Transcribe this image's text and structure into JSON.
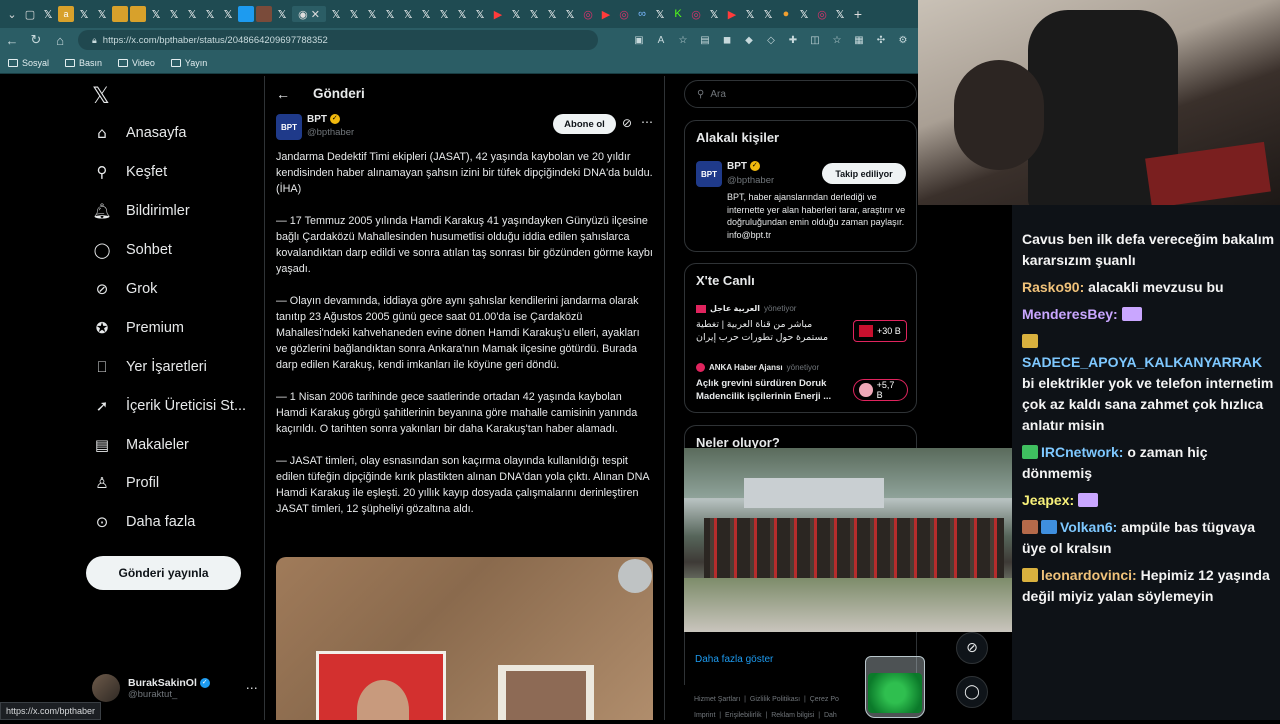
{
  "browser": {
    "url": "https://x.com/bpthaber/status/2048664209697788352",
    "bookmarks": [
      "Sosyal",
      "Basın",
      "Video",
      "Yayın"
    ],
    "status_url": "https://x.com/bpthaber"
  },
  "sidebar": {
    "items": [
      {
        "label": "Anasayfa",
        "icon": "home-icon"
      },
      {
        "label": "Keşfet",
        "icon": "search-icon"
      },
      {
        "label": "Bildirimler",
        "icon": "bell-icon"
      },
      {
        "label": "Sohbet",
        "icon": "chat-icon"
      },
      {
        "label": "Grok",
        "icon": "grok-icon"
      },
      {
        "label": "Premium",
        "icon": "premium-icon"
      },
      {
        "label": "Yer İşaretleri",
        "icon": "bookmark-icon"
      },
      {
        "label": "İçerik Üreticisi St...",
        "icon": "rocket-icon"
      },
      {
        "label": "Makaleler",
        "icon": "article-icon"
      },
      {
        "label": "Profil",
        "icon": "profile-icon"
      },
      {
        "label": "Daha fazla",
        "icon": "more-icon"
      }
    ],
    "post_button": "Gönderi yayınla",
    "user": {
      "name": "BurakSakinOl",
      "handle": "@buraktut_"
    }
  },
  "main": {
    "header_title": "Gönderi",
    "author": {
      "name": "BPT",
      "handle": "@bpthaber",
      "logo": "BPT"
    },
    "subscribe_label": "Abone ol",
    "paragraphs": [
      "Jandarma Dedektif Timi ekipleri (JASAT), 42 yaşında kaybolan ve 20 yıldır kendisinden haber alınamayan şahsın izini bir tüfek dipçiğindeki DNA'da buldu. (İHA)",
      "— 17 Temmuz 2005 yılında Hamdi Karakuş 41 yaşındayken Günyüzü ilçesine bağlı Çardaközü Mahallesinden husumetlisi olduğu iddia edilen şahıslarca kovalandıktan darp edildi ve sonra atılan taş sonrası bir gözünden görme kaybı yaşadı.",
      "— Olayın devamında, iddiaya göre aynı şahıslar kendilerini jandarma olarak tanıtıp 23 Ağustos 2005 günü gece saat 01.00'da ise Çardaközü Mahallesi'ndeki kahvehaneden evine dönen Hamdi Karakuş'u elleri, ayakları ve gözlerini bağlandıktan sonra Ankara'nın Mamak ilçesine götürdü. Burada darp edilen Karakuş, kendi imkanları ile köyüne geri döndü.",
      "— 1 Nisan 2006 tarihinde gece saatlerinde ortadan 42 yaşında kaybolan Hamdi Karakuş görgü şahitlerinin beyanına göre mahalle camisinin yanında kaçırıldı. O tarihten sonra yakınları bir daha Karakuş'tan haber alamadı.",
      "— JASAT timleri, olay esnasından son kaçırma olayında kullanıldığı tespit edilen tüfeğin dipçiğinde kırık plastikten alınan DNA'dan yola çıktı. Alınan DNA Hamdi Karakuş ile eşleşti. 20 yıllık kayıp dosyada çalışmalarını derinleştiren JASAT timleri, 12 şüpheliyi gözaltına aldı."
    ]
  },
  "right": {
    "search_placeholder": "Ara",
    "related_title": "Alakalı kişiler",
    "related_person": {
      "name": "BPT",
      "handle": "@bpthaber",
      "follow_label": "Takip ediliyor",
      "bio": "BPT, haber ajanslarından derlediği ve internette yer alan haberleri tarar, araştırır ve doğruluğundan emin olduğu zaman paylaşır. info@bpt.tr"
    },
    "live_title": "X'te Canlı",
    "live_items": [
      {
        "host": "العربية عاجل",
        "role": "yönetiyor",
        "title": "مباشر من قناة العربية | تغطية مستمرة حول تطورات حرب إيران",
        "count": "+30 B"
      },
      {
        "host": "ANKA Haber Ajansı",
        "role": "yönetiyor",
        "title": "Açlık grevini sürdüren Doruk Madencilik işçilerinin Enerji ...",
        "count": "+5,7 B"
      }
    ],
    "trending_title": "Neler oluyor?",
    "show_more": "Daha fazla göster",
    "footer_links": [
      "Hizmet Şartları",
      "Gizlilik Politikası",
      "Çerez Po",
      "Imprint",
      "Erişilebilirlik",
      "Reklam bilgisi",
      "Dah"
    ]
  },
  "chat": {
    "messages": [
      {
        "user": "",
        "text": "Cavus ben ilk defa vereceğim bakalım kararsızım şuanlı",
        "color": "#f4f4f4"
      },
      {
        "user": "Rasko90:",
        "text": "alacakli mevzusu bu",
        "color": "#f0c27a"
      },
      {
        "user": "MenderesBey:",
        "text": "",
        "color": "#c9a6ff"
      },
      {
        "user": "SADECE_APOYA_KALKANYARRAK",
        "text": "bi elektrikler yok ve telefon internetim çok az kaldı sana zahmet çok hızlıca anlatır misin",
        "color": "#7ec8ff"
      },
      {
        "user": "IRCnetwork:",
        "text": "o zaman hiç dönmemiş",
        "color": "#7ec8ff"
      },
      {
        "user": "Jeapex:",
        "text": "",
        "color": "#f8f17a"
      },
      {
        "user": "Volkan6:",
        "text": "ampüle bas tügvaya üye ol kralsın",
        "color": "#7ec8ff"
      },
      {
        "user": "leonardovinci:",
        "text": "Hepimiz 12 yaşında değil miyiz yalan söylemeyin",
        "color": "#f0c27a"
      }
    ]
  }
}
